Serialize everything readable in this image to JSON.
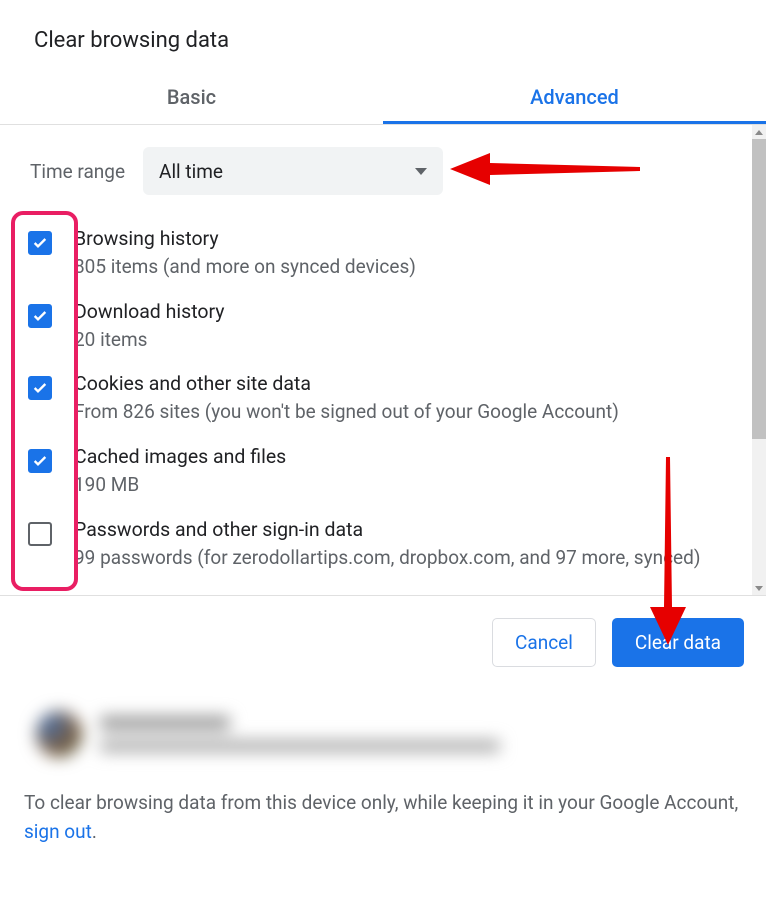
{
  "title": "Clear browsing data",
  "tabs": {
    "basic": "Basic",
    "advanced": "Advanced"
  },
  "timerange": {
    "label": "Time range",
    "value": "All time"
  },
  "items": [
    {
      "title": "Browsing history",
      "sub": "805 items (and more on synced devices)",
      "checked": true
    },
    {
      "title": "Download history",
      "sub": "20 items",
      "checked": true
    },
    {
      "title": "Cookies and other site data",
      "sub": "From 826 sites (you won't be signed out of your Google Account)",
      "checked": true
    },
    {
      "title": "Cached images and files",
      "sub": "190 MB",
      "checked": true
    },
    {
      "title": "Passwords and other sign-in data",
      "sub": "99 passwords (for zerodollartips.com, dropbox.com, and 97 more, synced)",
      "checked": false
    }
  ],
  "buttons": {
    "cancel": "Cancel",
    "clear": "Clear data"
  },
  "bottom": {
    "pre": "To clear browsing data from this device only, while keeping it in your Google Account, ",
    "link": "sign out",
    "post": "."
  }
}
